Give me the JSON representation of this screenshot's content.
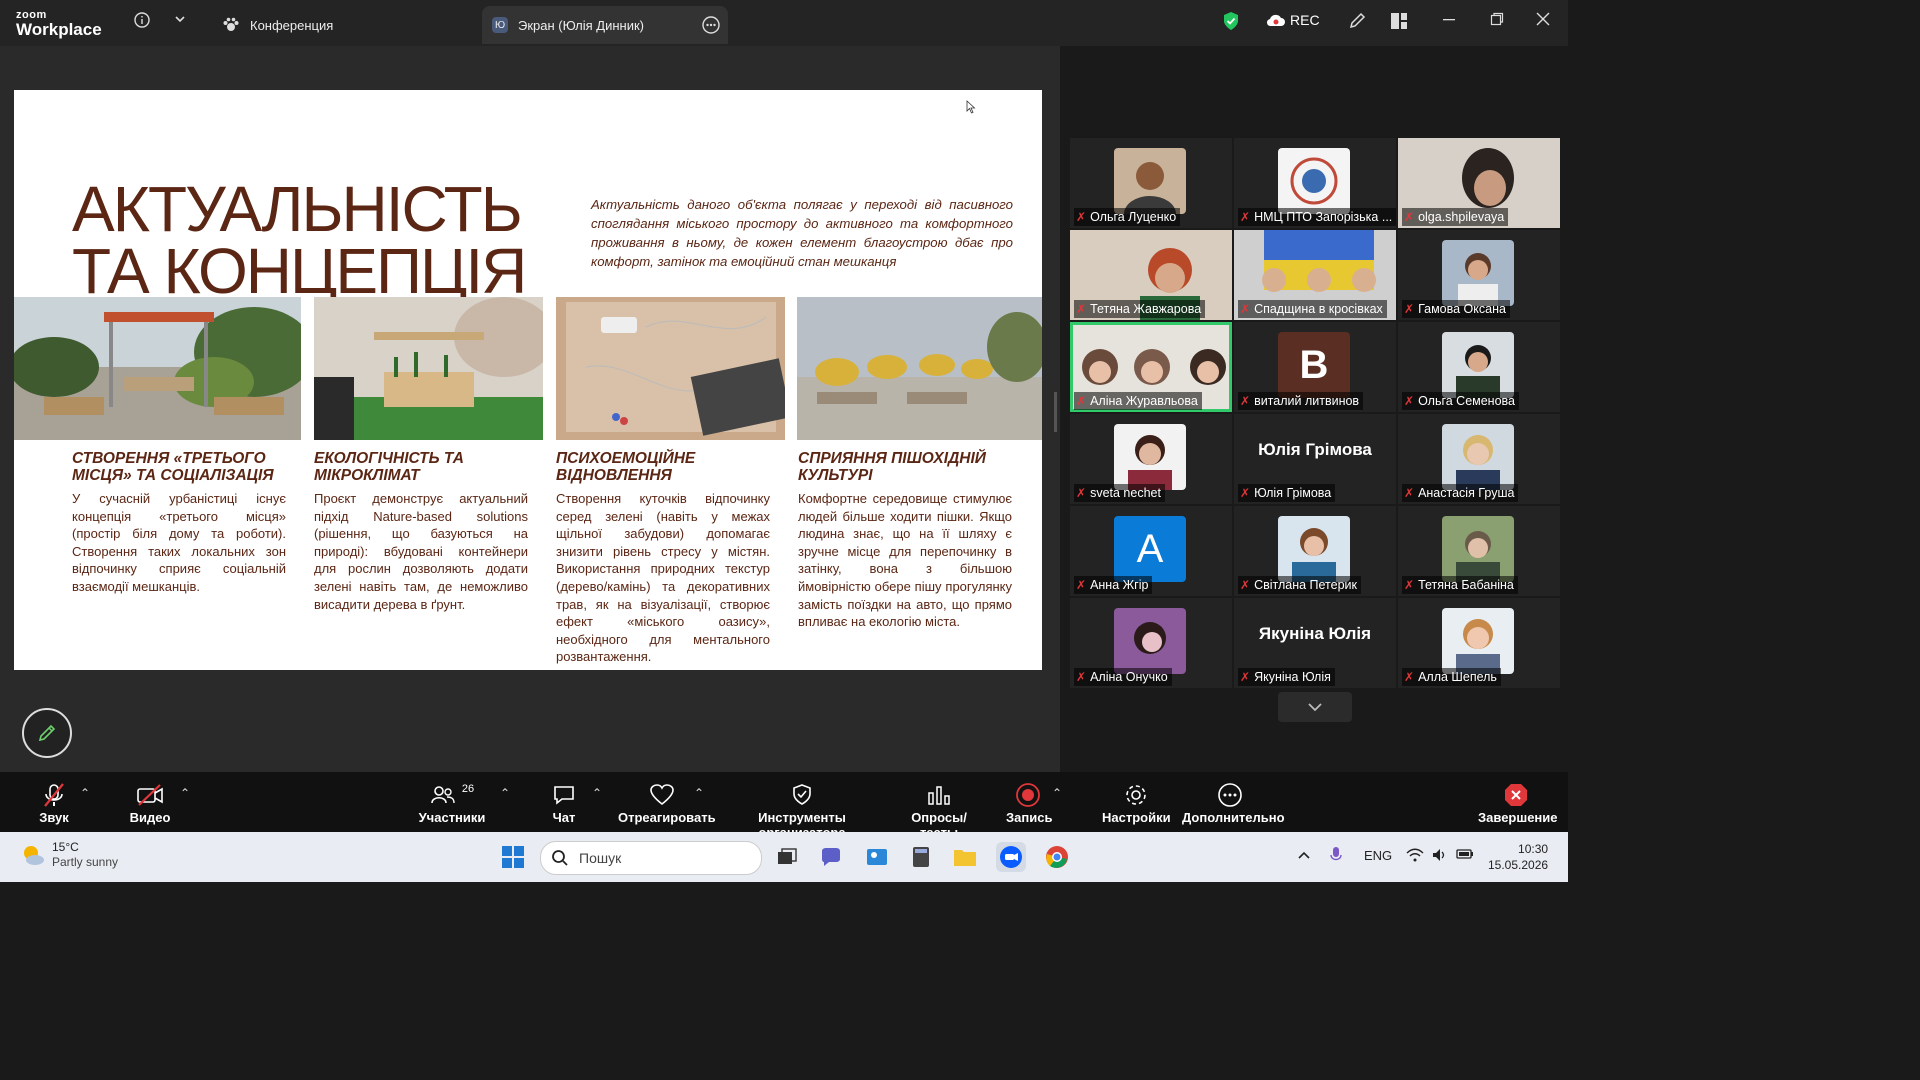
{
  "app": {
    "logo_top": "zoom",
    "logo_bottom": "Workplace"
  },
  "tabs": [
    {
      "label": "Конференция"
    },
    {
      "label": "Экран (Юлія Динник)",
      "badge": "Ю"
    }
  ],
  "topbar_right": {
    "rec_label": "REC"
  },
  "slide": {
    "title_line1": "АКТУАЛЬНІСТЬ",
    "title_line2": "ТА КОНЦЕПЦІЯ",
    "intro": "Актуальність даного об'єкта полягає у переході від пасивного споглядання міського простору до активного та комфортного проживання в ньому, де кожен елемент благоустрою дбає про комфорт, затінок та емоційний стан мешканця",
    "columns": [
      {
        "heading": "СТВОРЕННЯ «ТРЕТЬОГО МІСЦЯ» ТА СОЦІАЛІЗАЦІЯ",
        "text": "У сучасній урбаністиці існує концепція «третього місця» (простір біля дому та роботи). Створення таких локальних зон відпочинку сприяє соціальній взаємодії мешканців."
      },
      {
        "heading": "ЕКОЛОГІЧНІСТЬ ТА МІКРОКЛІМАТ",
        "text": "Проєкт демонструє актуальний підхід Nature-based solutions (рішення, що базуються на природі): вбудовані контейнери для рослин дозволяють додати зелені навіть там, де неможливо висадити дерева в ґрунт."
      },
      {
        "heading": "ПСИХОЕМОЦІЙНЕ ВІДНОВЛЕННЯ",
        "text": "Створення куточків відпочинку серед зелені (навіть у межах щільної забудови) допомагає знизити рівень стресу у містян. Використання природних текстур (дерево/камінь) та декоративних трав, як на візуалізації, створює ефект «міського оазису», необхідного для ментального розвантаження."
      },
      {
        "heading": "СПРИЯННЯ ПІШОХІДНІЙ КУЛЬТУРІ",
        "text": "Комфортне середовище стимулює людей більше ходити пішки. Якщо людина знає, що на її шляху є зручне місце для перепочинку в затінку, вона з більшою ймовірністю обере пішу прогулянку замість поїздки на авто, що прямо впливає на екологію міста."
      }
    ]
  },
  "participants": [
    {
      "name": "Ольга Луценко"
    },
    {
      "name": "НМЦ ПТО Запорізька ..."
    },
    {
      "name": "olga.shpilevaya"
    },
    {
      "name": "Тетяна Жавжарова"
    },
    {
      "name": "Спадщина в кросівках"
    },
    {
      "name": "Гамова Оксана"
    },
    {
      "name": "Аліна Журавльова"
    },
    {
      "name": "виталий литвинов",
      "initial": "В"
    },
    {
      "name": "Ольга Семенова"
    },
    {
      "name": "sveta nechet"
    },
    {
      "name": "Юлія Грімова",
      "big_name": "Юлія Грімова"
    },
    {
      "name": "Анастасія Груша"
    },
    {
      "name": "Анна Жгір",
      "initial": "А"
    },
    {
      "name": "Світлана Петерик"
    },
    {
      "name": "Тетяна Бабаніна"
    },
    {
      "name": "Аліна Онучко"
    },
    {
      "name": "Якуніна Юлія",
      "big_name": "Якуніна Юлія"
    },
    {
      "name": "Алла Шепель"
    }
  ],
  "toolbar": {
    "audio": "Звук",
    "video": "Видео",
    "participants": "Участники",
    "participants_count": "26",
    "chat": "Чат",
    "react": "Отреагировать",
    "host_tools": "Инструменты организатора",
    "polls": "Опросы/тесты",
    "record": "Запись",
    "settings": "Настройки",
    "more": "Дополнительно",
    "end": "Завершение"
  },
  "taskbar": {
    "temp": "15°C",
    "weather": "Partly sunny",
    "search_placeholder": "Пошук",
    "lang": "ENG",
    "time": "10:30",
    "date": "15.05.2026"
  }
}
